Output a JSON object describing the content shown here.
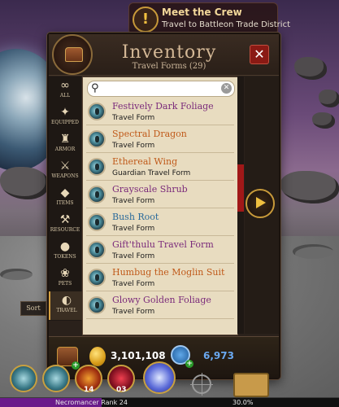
{
  "quest": {
    "title": "Meet the Crew",
    "subtitle": "Travel to Battleon Trade District"
  },
  "inventory": {
    "title": "Inventory",
    "subtitle": "Travel Forms (29)",
    "close_label": "✕",
    "categories": [
      {
        "label": "All",
        "icon": "infinity-icon",
        "glyph": "∞"
      },
      {
        "label": "Equipped",
        "icon": "equipped-icon",
        "glyph": "✦"
      },
      {
        "label": "Armor",
        "icon": "armor-icon",
        "glyph": "♜"
      },
      {
        "label": "Weapons",
        "icon": "sword-icon",
        "glyph": "⚔"
      },
      {
        "label": "Items",
        "icon": "bag-icon",
        "glyph": "◆"
      },
      {
        "label": "Resource",
        "icon": "tools-icon",
        "glyph": "⚒"
      },
      {
        "label": "Tokens",
        "icon": "token-icon",
        "glyph": "●"
      },
      {
        "label": "Pets",
        "icon": "paw-icon",
        "glyph": "❀"
      },
      {
        "label": "Travel",
        "icon": "travel-icon",
        "glyph": "◐"
      }
    ],
    "active_category": "Travel",
    "search": {
      "value": "",
      "placeholder": ""
    },
    "items": [
      {
        "name": "Festively Dark Foliage",
        "type": "Travel Form",
        "color": "#7a2a7a"
      },
      {
        "name": "Spectral Dragon",
        "type": "Travel Form",
        "color": "#c05a1a"
      },
      {
        "name": "Ethereal Wing",
        "type": "Guardian Travel Form",
        "color": "#c05a1a"
      },
      {
        "name": "Grayscale Shrub",
        "type": "Travel Form",
        "color": "#7a2a7a"
      },
      {
        "name": "Bush Root",
        "type": "Travel Form",
        "color": "#2a6a9a"
      },
      {
        "name": "Gift'thulu Travel Form",
        "type": "Travel Form",
        "color": "#7a2a7a"
      },
      {
        "name": "Humbug the Moglin Suit",
        "type": "Travel Form",
        "color": "#c05a1a"
      },
      {
        "name": "Glowy Golden Foliage",
        "type": "Travel Form",
        "color": "#7a2a7a"
      }
    ],
    "gold": "3,101,108",
    "ac": "6,973",
    "plus_label": "+"
  },
  "sort_label": "Sort",
  "actionbar": {
    "slot_numbers": [
      "14",
      "03"
    ],
    "rank_label": "Necromancer Rank 24",
    "rank_percent_label": "30.0%",
    "rank_percent": 30
  },
  "colors": {
    "accent_gold": "#c89a3a",
    "close_red": "#8a1a14",
    "ac_blue": "#6aa8f0"
  }
}
